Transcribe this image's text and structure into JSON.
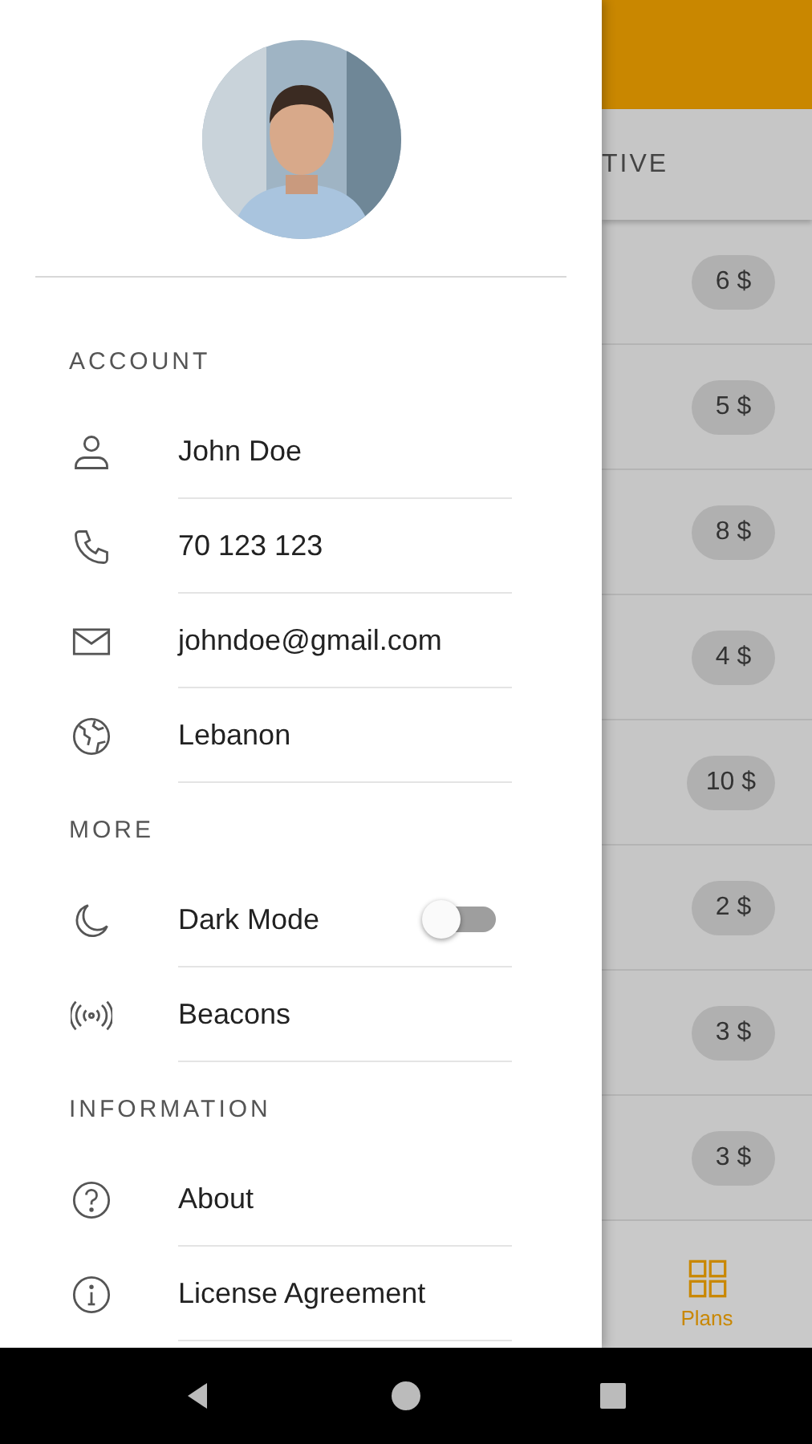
{
  "drawer": {
    "sections": [
      {
        "title": "ACCOUNT",
        "items": [
          {
            "kind": "text",
            "label": "John Doe"
          },
          {
            "kind": "text",
            "label": "70 123 123"
          },
          {
            "kind": "text",
            "label": "johndoe@gmail.com"
          },
          {
            "kind": "text",
            "label": "Lebanon"
          }
        ]
      },
      {
        "title": "MORE",
        "items": [
          {
            "kind": "toggle",
            "label": "Dark Mode",
            "on": false
          },
          {
            "kind": "text",
            "label": "Beacons"
          }
        ]
      },
      {
        "title": "INFORMATION",
        "items": [
          {
            "kind": "text",
            "label": "About"
          },
          {
            "kind": "text",
            "label": "License Agreement"
          }
        ]
      }
    ]
  },
  "background": {
    "tab_label": "TIVE",
    "prices": [
      "6 $",
      "5 $",
      "8 $",
      "4 $",
      "10 $",
      "2 $",
      "3 $",
      "3 $"
    ],
    "bottom_nav": [
      {
        "label": "Plans",
        "selected": true
      }
    ]
  }
}
